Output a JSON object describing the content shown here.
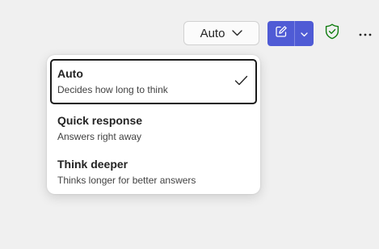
{
  "toolbar": {
    "mode_label": "Auto",
    "accent_color": "#4f5bd5",
    "shield_color": "#107c10",
    "icons": {
      "mode_chevron": "chevron-down-icon",
      "compose": "compose-icon",
      "split_caret": "chevron-down-icon",
      "shield": "shield-check-icon",
      "more": "more-icon"
    }
  },
  "menu": {
    "items": [
      {
        "title": "Auto",
        "description": "Decides how long to think",
        "selected": true
      },
      {
        "title": "Quick response",
        "description": "Answers right away",
        "selected": false
      },
      {
        "title": "Think deeper",
        "description": "Thinks longer for better answers",
        "selected": false
      }
    ]
  }
}
